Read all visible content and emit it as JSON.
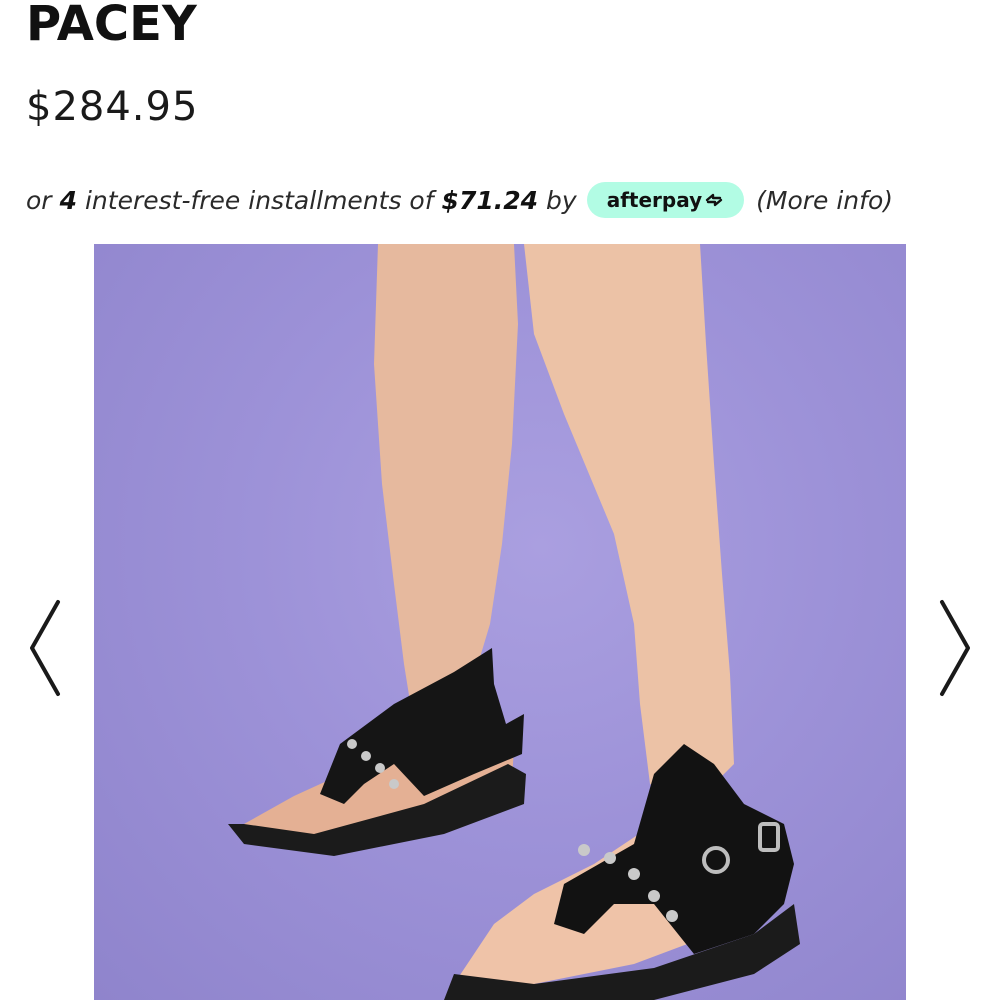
{
  "product": {
    "name": "PACEY",
    "price": "$284.95"
  },
  "installments": {
    "prefix": "or",
    "count": "4",
    "middle": "interest-free installments of",
    "amount": "$71.24",
    "suffix": "by",
    "provider": "afterpay",
    "more_info": "(More info)",
    "badge_color": "#b2fce4"
  },
  "carousel": {
    "image_icon": "product-photo",
    "prev_icon": "chevron-left-icon",
    "next_icon": "chevron-right-icon",
    "background_color": "#9d92d8"
  }
}
